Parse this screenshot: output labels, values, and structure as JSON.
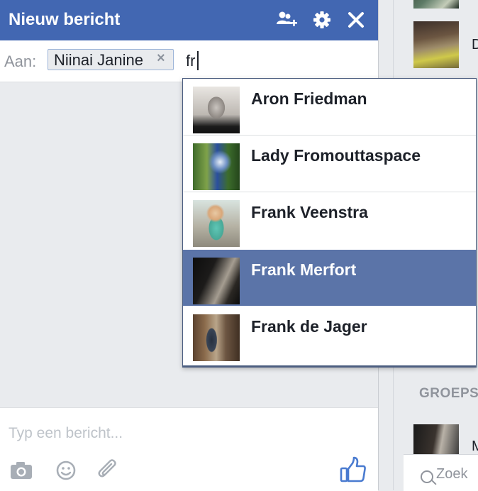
{
  "sidebar": {
    "partial_initial_1": "D",
    "section_title": "GROEPS",
    "partial_initial_2": "M",
    "search_placeholder": "Zoek"
  },
  "chat": {
    "title": "Nieuw bericht",
    "header_icons": [
      "add-people-icon",
      "gear-icon",
      "close-icon"
    ],
    "to_label": "Aan:",
    "recipients": [
      {
        "label": "Niinai Janine",
        "remove": "×"
      }
    ],
    "to_input_value": "fr",
    "message_placeholder": "Typ een bericht...",
    "composer_icons": [
      "camera-icon",
      "emoji-icon",
      "paperclip-icon",
      "thumbs-up-icon"
    ]
  },
  "typeahead": {
    "results": [
      {
        "name": "Aron Friedman",
        "selected": false
      },
      {
        "name": "Lady Fromouttaspace",
        "selected": false
      },
      {
        "name": "Frank Veenstra",
        "selected": false
      },
      {
        "name": "Frank Merfort",
        "selected": true
      },
      {
        "name": "Frank de Jager",
        "selected": false
      }
    ]
  },
  "colors": {
    "header": "#4267b2",
    "selected_row": "#5b74a8",
    "like_icon": "#4a7bd0"
  }
}
